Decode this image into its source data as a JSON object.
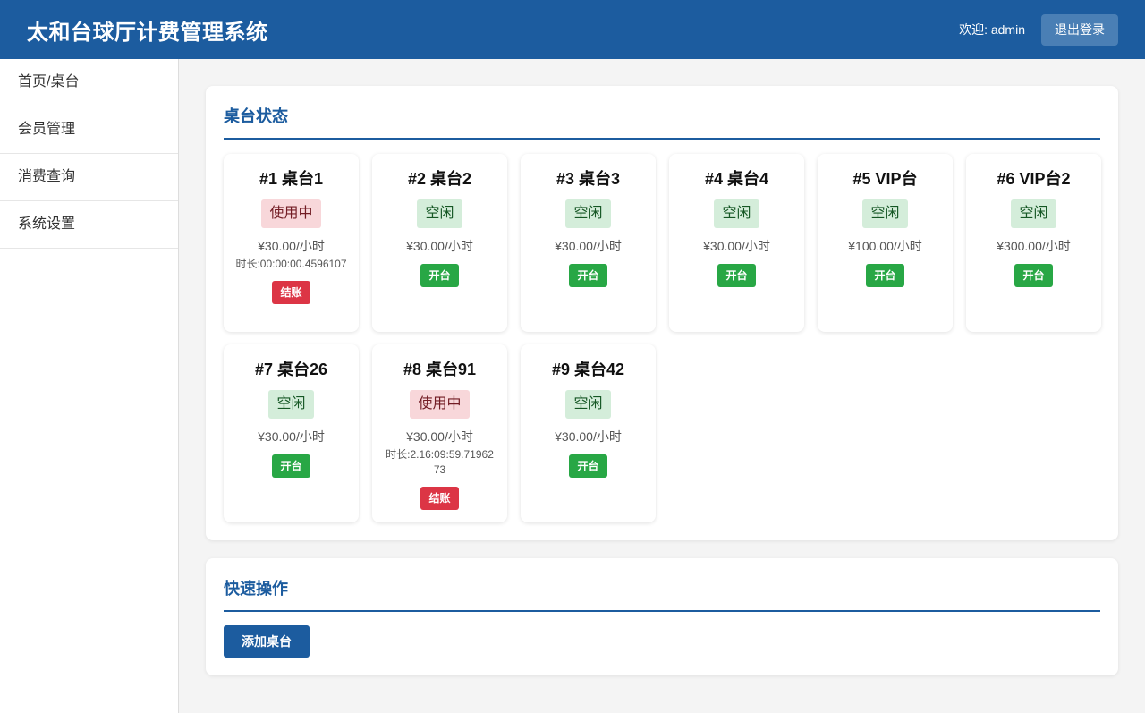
{
  "header": {
    "title": "太和台球厅计费管理系统",
    "welcome": "欢迎: admin",
    "logout_label": "退出登录"
  },
  "sidebar": {
    "items": [
      {
        "label": "首页/桌台"
      },
      {
        "label": "会员管理"
      },
      {
        "label": "消费查询"
      },
      {
        "label": "系统设置"
      }
    ]
  },
  "tables_panel": {
    "title": "桌台状态",
    "tables": [
      {
        "name": "#1 桌台1",
        "status": "使用中",
        "price": "¥30.00/小时",
        "duration": "时长:00:00:00.4596107",
        "action": "结账"
      },
      {
        "name": "#2 桌台2",
        "status": "空闲",
        "price": "¥30.00/小时",
        "action": "开台"
      },
      {
        "name": "#3 桌台3",
        "status": "空闲",
        "price": "¥30.00/小时",
        "action": "开台"
      },
      {
        "name": "#4 桌台4",
        "status": "空闲",
        "price": "¥30.00/小时",
        "action": "开台"
      },
      {
        "name": "#5 VIP台",
        "status": "空闲",
        "price": "¥100.00/小时",
        "action": "开台"
      },
      {
        "name": "#6 VIP台2",
        "status": "空闲",
        "price": "¥300.00/小时",
        "action": "开台"
      },
      {
        "name": "#7 桌台26",
        "status": "空闲",
        "price": "¥30.00/小时",
        "action": "开台"
      },
      {
        "name": "#8 桌台91",
        "status": "使用中",
        "price": "¥30.00/小时",
        "duration": "时长:2.16:09:59.7196273",
        "action": "结账"
      },
      {
        "name": "#9 桌台42",
        "status": "空闲",
        "price": "¥30.00/小时",
        "action": "开台"
      }
    ]
  },
  "quick_panel": {
    "title": "快速操作",
    "add_label": "添加桌台"
  },
  "colors": {
    "primary": "#1c5c9f",
    "busy_bg": "#f8d7da",
    "free_bg": "#d4edda",
    "open_button": "#28a745",
    "checkout_button": "#dc3545"
  }
}
